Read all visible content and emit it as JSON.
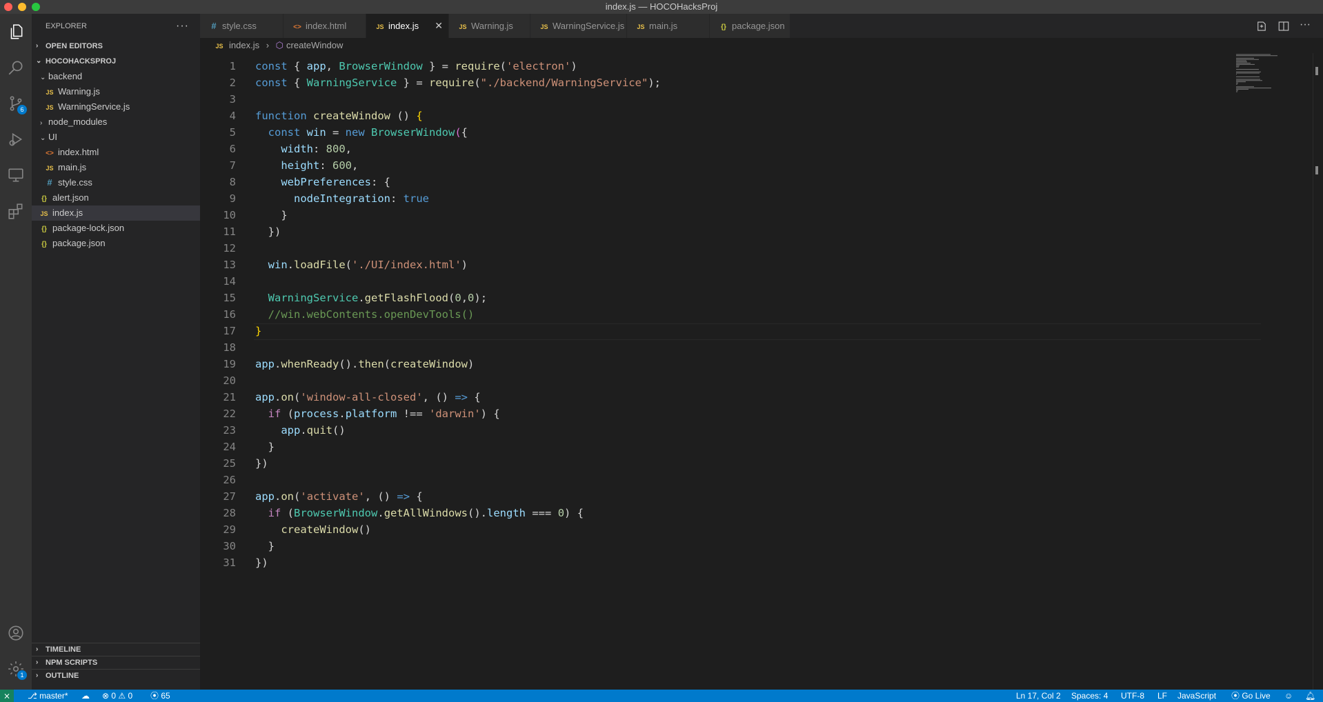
{
  "window": {
    "title": "index.js — HOCOHacksProj"
  },
  "activity_bar": {
    "scm_badge": "6",
    "settings_badge": "1"
  },
  "sidebar": {
    "title": "EXPLORER",
    "more": "···",
    "open_editors": "OPEN EDITORS",
    "project": "HOCOHACKSPROJ",
    "tree": [
      {
        "label": "backend",
        "type": "folder",
        "expanded": true,
        "depth": 1
      },
      {
        "label": "Warning.js",
        "type": "js",
        "depth": 2
      },
      {
        "label": "WarningService.js",
        "type": "js",
        "depth": 2
      },
      {
        "label": "node_modules",
        "type": "folder",
        "expanded": false,
        "depth": 1
      },
      {
        "label": "UI",
        "type": "folder",
        "expanded": true,
        "depth": 1
      },
      {
        "label": "index.html",
        "type": "html",
        "depth": 2
      },
      {
        "label": "main.js",
        "type": "js",
        "depth": 2
      },
      {
        "label": "style.css",
        "type": "css",
        "depth": 2
      },
      {
        "label": "alert.json",
        "type": "json",
        "depth": 1
      },
      {
        "label": "index.js",
        "type": "js",
        "depth": 1,
        "active": true
      },
      {
        "label": "package-lock.json",
        "type": "json",
        "depth": 1
      },
      {
        "label": "package.json",
        "type": "json",
        "depth": 1
      }
    ],
    "panels": [
      "TIMELINE",
      "NPM SCRIPTS",
      "OUTLINE"
    ]
  },
  "tabs": [
    {
      "label": "style.css",
      "type": "css"
    },
    {
      "label": "index.html",
      "type": "html"
    },
    {
      "label": "index.js",
      "type": "js",
      "active": true
    },
    {
      "label": "Warning.js",
      "type": "js"
    },
    {
      "label": "WarningService.js",
      "type": "js"
    },
    {
      "label": "main.js",
      "type": "js"
    },
    {
      "label": "package.json",
      "type": "json"
    }
  ],
  "breadcrumb": {
    "file": "index.js",
    "symbol": "createWindow"
  },
  "icons": {
    "js": "JS",
    "html": "<>",
    "css": "#",
    "json": "{}",
    "close": "✕",
    "chevron_right": "›",
    "chevron_down": "⌄"
  },
  "code_lines": [
    [
      [
        "kw",
        "const "
      ],
      [
        "p",
        "{ "
      ],
      [
        "vr",
        "app"
      ],
      [
        "p",
        ", "
      ],
      [
        "cls",
        "BrowserWindow"
      ],
      [
        "p",
        " } = "
      ],
      [
        "fn",
        "require"
      ],
      [
        "p",
        "("
      ],
      [
        "str",
        "'electron'"
      ],
      [
        "p",
        ")"
      ]
    ],
    [
      [
        "kw",
        "const "
      ],
      [
        "p",
        "{ "
      ],
      [
        "cls",
        "WarningService"
      ],
      [
        "p",
        " } = "
      ],
      [
        "fn",
        "require"
      ],
      [
        "p",
        "("
      ],
      [
        "str",
        "\"./backend/WarningService\""
      ],
      [
        "p",
        ");"
      ]
    ],
    [],
    [
      [
        "kw",
        "function "
      ],
      [
        "fn",
        "createWindow"
      ],
      [
        "p",
        " () "
      ],
      [
        "br",
        "{"
      ]
    ],
    [
      [
        "p",
        "  "
      ],
      [
        "kw",
        "const "
      ],
      [
        "vr",
        "win"
      ],
      [
        "p",
        " = "
      ],
      [
        "kw",
        "new "
      ],
      [
        "cls",
        "BrowserWindow"
      ],
      [
        "br2",
        "("
      ],
      [
        "p",
        "{"
      ]
    ],
    [
      [
        "p",
        "    "
      ],
      [
        "vr",
        "width"
      ],
      [
        "p",
        ": "
      ],
      [
        "num",
        "800"
      ],
      [
        "p",
        ","
      ]
    ],
    [
      [
        "p",
        "    "
      ],
      [
        "vr",
        "height"
      ],
      [
        "p",
        ": "
      ],
      [
        "num",
        "600"
      ],
      [
        "p",
        ","
      ]
    ],
    [
      [
        "p",
        "    "
      ],
      [
        "vr",
        "webPreferences"
      ],
      [
        "p",
        ": {"
      ]
    ],
    [
      [
        "p",
        "      "
      ],
      [
        "vr",
        "nodeIntegration"
      ],
      [
        "p",
        ": "
      ],
      [
        "kw",
        "true"
      ]
    ],
    [
      [
        "p",
        "    }"
      ]
    ],
    [
      [
        "p",
        "  })"
      ]
    ],
    [],
    [
      [
        "p",
        "  "
      ],
      [
        "vr",
        "win"
      ],
      [
        "p",
        "."
      ],
      [
        "fn",
        "loadFile"
      ],
      [
        "p",
        "("
      ],
      [
        "str",
        "'./UI/index.html'"
      ],
      [
        "p",
        ")"
      ]
    ],
    [],
    [
      [
        "p",
        "  "
      ],
      [
        "cls",
        "WarningService"
      ],
      [
        "p",
        "."
      ],
      [
        "fn",
        "getFlashFlood"
      ],
      [
        "p",
        "("
      ],
      [
        "num",
        "0"
      ],
      [
        "p",
        ","
      ],
      [
        "num",
        "0"
      ],
      [
        "p",
        ");"
      ]
    ],
    [
      [
        "p",
        "  "
      ],
      [
        "cm",
        "//win.webContents.openDevTools()"
      ]
    ],
    [
      [
        "br",
        "}"
      ]
    ],
    [],
    [
      [
        "vr",
        "app"
      ],
      [
        "p",
        "."
      ],
      [
        "fn",
        "whenReady"
      ],
      [
        "p",
        "()."
      ],
      [
        "fn",
        "then"
      ],
      [
        "p",
        "("
      ],
      [
        "fn",
        "createWindow"
      ],
      [
        "p",
        ")"
      ]
    ],
    [],
    [
      [
        "vr",
        "app"
      ],
      [
        "p",
        "."
      ],
      [
        "fn",
        "on"
      ],
      [
        "p",
        "("
      ],
      [
        "str",
        "'window-all-closed'"
      ],
      [
        "p",
        ", () "
      ],
      [
        "kw",
        "=>"
      ],
      [
        "p",
        " {"
      ]
    ],
    [
      [
        "p",
        "  "
      ],
      [
        "kc",
        "if"
      ],
      [
        "p",
        " ("
      ],
      [
        "vr",
        "process"
      ],
      [
        "p",
        "."
      ],
      [
        "vr",
        "platform"
      ],
      [
        "p",
        " !== "
      ],
      [
        "str",
        "'darwin'"
      ],
      [
        "p",
        ") {"
      ]
    ],
    [
      [
        "p",
        "    "
      ],
      [
        "vr",
        "app"
      ],
      [
        "p",
        "."
      ],
      [
        "fn",
        "quit"
      ],
      [
        "p",
        "()"
      ]
    ],
    [
      [
        "p",
        "  }"
      ]
    ],
    [
      [
        "p",
        "})"
      ]
    ],
    [],
    [
      [
        "vr",
        "app"
      ],
      [
        "p",
        "."
      ],
      [
        "fn",
        "on"
      ],
      [
        "p",
        "("
      ],
      [
        "str",
        "'activate'"
      ],
      [
        "p",
        ", () "
      ],
      [
        "kw",
        "=>"
      ],
      [
        "p",
        " {"
      ]
    ],
    [
      [
        "p",
        "  "
      ],
      [
        "kc",
        "if"
      ],
      [
        "p",
        " ("
      ],
      [
        "cls",
        "BrowserWindow"
      ],
      [
        "p",
        "."
      ],
      [
        "fn",
        "getAllWindows"
      ],
      [
        "p",
        "()."
      ],
      [
        "vr",
        "length"
      ],
      [
        "p",
        " === "
      ],
      [
        "num",
        "0"
      ],
      [
        "p",
        ") {"
      ]
    ],
    [
      [
        "p",
        "    "
      ],
      [
        "fn",
        "createWindow"
      ],
      [
        "p",
        "()"
      ]
    ],
    [
      [
        "p",
        "  }"
      ]
    ],
    [
      [
        "p",
        "})"
      ]
    ]
  ],
  "status": {
    "branch": "master*",
    "errors": "0",
    "warnings": "0",
    "ports": "65",
    "position": "Ln 17, Col 2",
    "spaces": "Spaces: 4",
    "encoding": "UTF-8",
    "eol": "LF",
    "language": "JavaScript",
    "golive": "Go Live"
  }
}
